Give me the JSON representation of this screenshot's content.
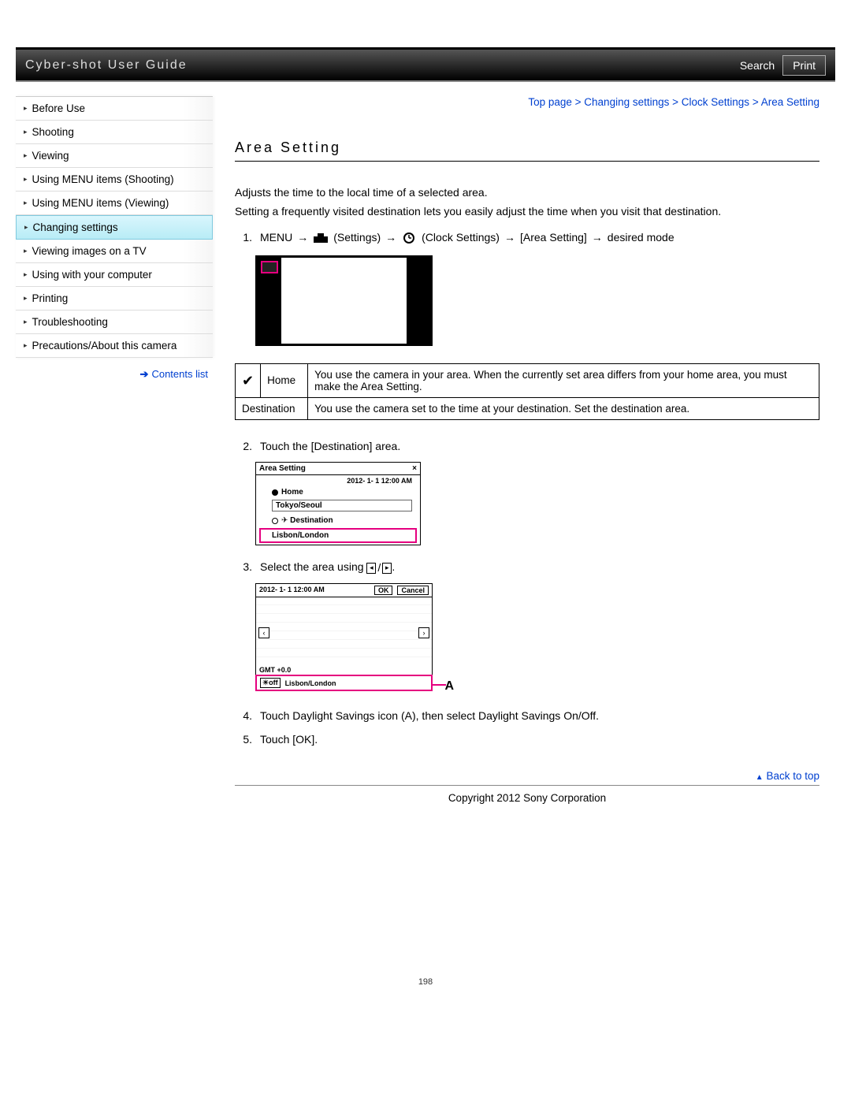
{
  "header": {
    "title": "Cyber-shot User Guide",
    "search": "Search",
    "print": "Print"
  },
  "sidebar": {
    "items": [
      {
        "label": "Before Use"
      },
      {
        "label": "Shooting"
      },
      {
        "label": "Viewing"
      },
      {
        "label": "Using MENU items (Shooting)"
      },
      {
        "label": "Using MENU items (Viewing)"
      },
      {
        "label": "Changing settings"
      },
      {
        "label": "Viewing images on a TV"
      },
      {
        "label": "Using with your computer"
      },
      {
        "label": "Printing"
      },
      {
        "label": "Troubleshooting"
      },
      {
        "label": "Precautions/About this camera"
      }
    ],
    "contents_list": "Contents list"
  },
  "breadcrumb": {
    "parts": [
      "Top page",
      "Changing settings",
      "Clock Settings",
      "Area Setting"
    ],
    "sep": " > "
  },
  "title": "Area Setting",
  "intro": {
    "l1": "Adjusts the time to the local time of a selected area.",
    "l2": "Setting a frequently visited destination lets you easily adjust the time when you visit that destination."
  },
  "step1": {
    "num": "1.",
    "menu": "MENU",
    "settings": "(Settings)",
    "clock": "(Clock Settings)",
    "area": "[Area Setting]",
    "desired": "desired mode"
  },
  "table": {
    "home_label": "Home",
    "home_desc": "You use the camera in your area. When the currently set area differs from your home area, you must make the Area Setting.",
    "dest_label": "Destination",
    "dest_desc": "You use the camera set to the time at your destination. Set the destination area."
  },
  "step2": {
    "num": "2.",
    "text": "Touch the [Destination] area.",
    "dlg_title": "Area Setting",
    "dlg_datetime": "2012- 1- 1  12:00 AM",
    "home": "Home",
    "home_city": "Tokyo/Seoul",
    "dest": "Destination",
    "dest_city": "Lisbon/London"
  },
  "step3": {
    "num": "3.",
    "text_pre": "Select the area using ",
    "text_post": ".",
    "map_datetime": "2012- 1- 1  12:00 AM",
    "ok": "OK",
    "cancel": "Cancel",
    "gmt": "GMT +0.0",
    "city": "Lisbon/London",
    "label_a": "A"
  },
  "step4": {
    "num": "4.",
    "text": "Touch Daylight Savings icon (A), then select Daylight Savings On/Off."
  },
  "step5": {
    "num": "5.",
    "text": "Touch [OK]."
  },
  "back_to_top": "Back to top",
  "copyright": "Copyright 2012 Sony Corporation",
  "page_number": "198"
}
